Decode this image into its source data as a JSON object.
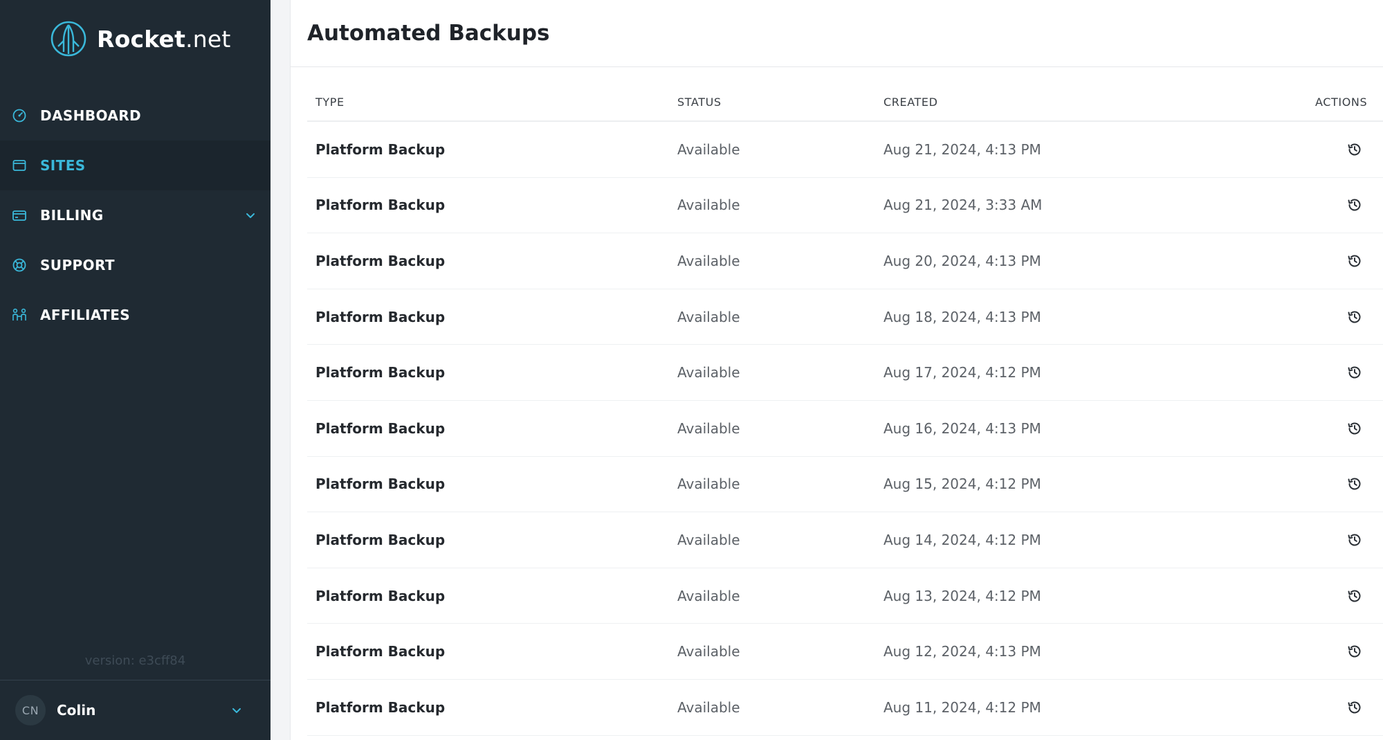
{
  "app": {
    "brand_bold": "Rocket",
    "brand_light": ".net",
    "accent_color": "#3ab8da",
    "sidebar_bg": "#1f2a33"
  },
  "sidebar": {
    "items": [
      {
        "label": "DASHBOARD",
        "icon": "gauge-icon",
        "active": false
      },
      {
        "label": "SITES",
        "icon": "browser-window-icon",
        "active": true
      },
      {
        "label": "BILLING",
        "icon": "credit-card-icon",
        "active": false,
        "has_submenu": true
      },
      {
        "label": "SUPPORT",
        "icon": "lifebuoy-icon",
        "active": false
      },
      {
        "label": "AFFILIATES",
        "icon": "people-icon",
        "active": false
      }
    ],
    "version": "version: e3cff84",
    "user": {
      "initials": "CN",
      "name": "Colin"
    }
  },
  "main": {
    "title": "Automated Backups",
    "table": {
      "headers": {
        "type": "TYPE",
        "status": "STATUS",
        "created": "CREATED",
        "actions": "ACTIONS"
      },
      "action_icon": "restore-history-icon",
      "rows": [
        {
          "type": "Platform Backup",
          "status": "Available",
          "created": "Aug 21, 2024, 4:13 PM"
        },
        {
          "type": "Platform Backup",
          "status": "Available",
          "created": "Aug 21, 2024, 3:33 AM"
        },
        {
          "type": "Platform Backup",
          "status": "Available",
          "created": "Aug 20, 2024, 4:13 PM"
        },
        {
          "type": "Platform Backup",
          "status": "Available",
          "created": "Aug 18, 2024, 4:13 PM"
        },
        {
          "type": "Platform Backup",
          "status": "Available",
          "created": "Aug 17, 2024, 4:12 PM"
        },
        {
          "type": "Platform Backup",
          "status": "Available",
          "created": "Aug 16, 2024, 4:13 PM"
        },
        {
          "type": "Platform Backup",
          "status": "Available",
          "created": "Aug 15, 2024, 4:12 PM"
        },
        {
          "type": "Platform Backup",
          "status": "Available",
          "created": "Aug 14, 2024, 4:12 PM"
        },
        {
          "type": "Platform Backup",
          "status": "Available",
          "created": "Aug 13, 2024, 4:12 PM"
        },
        {
          "type": "Platform Backup",
          "status": "Available",
          "created": "Aug 12, 2024, 4:13 PM"
        },
        {
          "type": "Platform Backup",
          "status": "Available",
          "created": "Aug 11, 2024, 4:12 PM"
        }
      ]
    }
  }
}
